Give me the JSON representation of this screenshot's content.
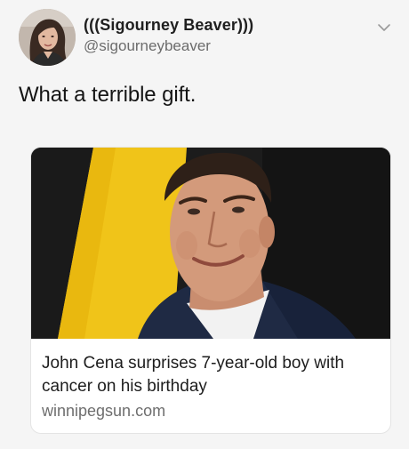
{
  "tweet": {
    "author": {
      "display_name": "(((Sigourney Beaver)))",
      "handle": "@sigourneybeaver",
      "avatar_icon": "profile-photo"
    },
    "menu_icon": "chevron-down-icon",
    "text": "What a terrible gift.",
    "card": {
      "image_icon": "article-photo-john-cena",
      "title": "John Cena surprises 7-year-old boy with cancer on his birthday",
      "domain": "winnipegsun.com"
    }
  },
  "colors": {
    "background": "#f5f5f5",
    "card_background": "#ffffff",
    "text_primary": "#151515",
    "text_secondary": "#6c6c6c",
    "photo_yellow": "#f0c419",
    "photo_dark": "#1a1a1a"
  }
}
